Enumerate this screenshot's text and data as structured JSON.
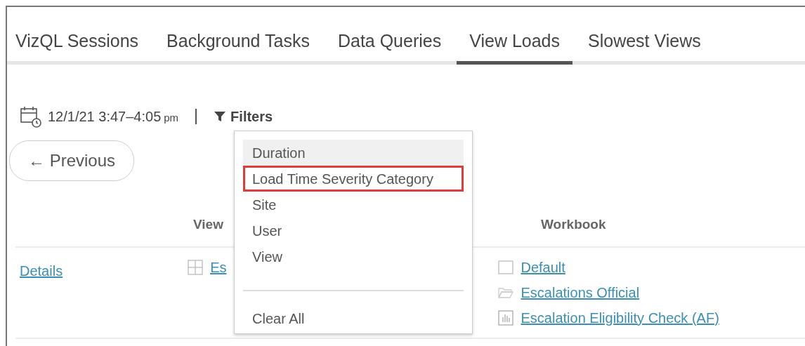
{
  "tabs": [
    {
      "label": "VizQL Sessions",
      "selected": false
    },
    {
      "label": "Background Tasks",
      "selected": false
    },
    {
      "label": "Data Queries",
      "selected": false
    },
    {
      "label": "View Loads",
      "selected": true
    },
    {
      "label": "Slowest Views",
      "selected": false
    }
  ],
  "time_range": {
    "text": "12/1/21 3:47–4:05",
    "suffix": "pm"
  },
  "filters_button": "Filters",
  "previous_button": "← Previous",
  "filters_menu": {
    "items": [
      {
        "label": "Duration",
        "hovered": true,
        "outlined": false
      },
      {
        "label": "Load Time Severity Category",
        "hovered": false,
        "outlined": true
      },
      {
        "label": "Site",
        "hovered": false,
        "outlined": false
      },
      {
        "label": "User",
        "hovered": false,
        "outlined": false
      },
      {
        "label": "View",
        "hovered": false,
        "outlined": false
      }
    ],
    "clear_all": "Clear All"
  },
  "table": {
    "columns": [
      "View",
      "Workbook"
    ],
    "rows": [
      {
        "link": "Details",
        "view": "Es",
        "workbook": [
          {
            "kind": "site",
            "label": "Default"
          },
          {
            "kind": "project",
            "label": "Escalations Official"
          },
          {
            "kind": "workbook",
            "label": "Escalation Eligibility Check (AF)"
          }
        ]
      }
    ]
  }
}
